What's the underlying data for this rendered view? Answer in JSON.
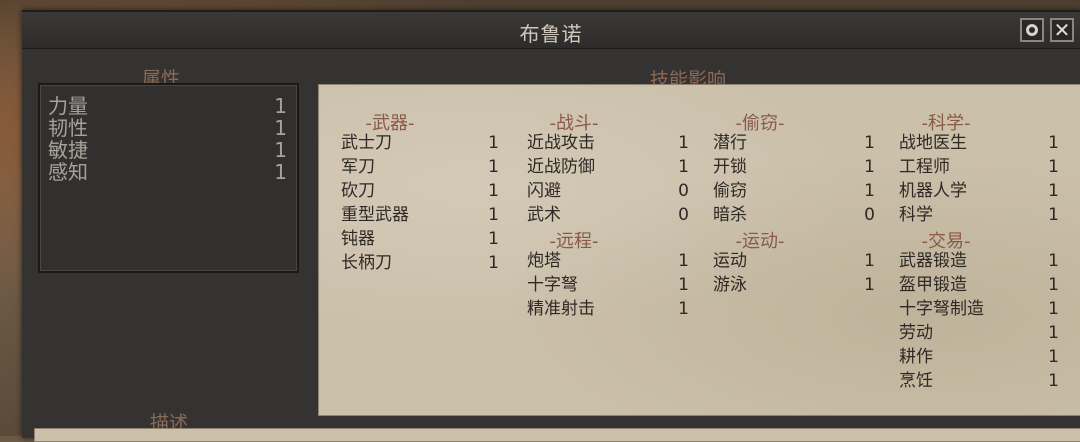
{
  "window": {
    "title": "布鲁诺"
  },
  "attributes": {
    "label": "属性",
    "items": [
      {
        "name": "力量",
        "value": "1"
      },
      {
        "name": "韧性",
        "value": "1"
      },
      {
        "name": "敏捷",
        "value": "1"
      },
      {
        "name": "感知",
        "value": "1"
      }
    ]
  },
  "skills": {
    "label": "技能影响",
    "categories": {
      "weapons": {
        "title": "-武器-",
        "items": [
          {
            "name": "武士刀",
            "value": "1"
          },
          {
            "name": "军刀",
            "value": "1"
          },
          {
            "name": "砍刀",
            "value": "1"
          },
          {
            "name": "重型武器",
            "value": "1"
          },
          {
            "name": "钝器",
            "value": "1"
          },
          {
            "name": "长柄刀",
            "value": "1"
          }
        ]
      },
      "combat": {
        "title": "-战斗-",
        "items": [
          {
            "name": "近战攻击",
            "value": "1"
          },
          {
            "name": "近战防御",
            "value": "1"
          },
          {
            "name": "闪避",
            "value": "0"
          },
          {
            "name": "武术",
            "value": "0"
          }
        ]
      },
      "ranged": {
        "title": "-远程-",
        "items": [
          {
            "name": "炮塔",
            "value": "1"
          },
          {
            "name": "十字弩",
            "value": "1"
          },
          {
            "name": "精准射击",
            "value": "1"
          }
        ]
      },
      "stealth": {
        "title": "-偷窃-",
        "items": [
          {
            "name": "潜行",
            "value": "1"
          },
          {
            "name": "开锁",
            "value": "1"
          },
          {
            "name": "偷窃",
            "value": "1"
          },
          {
            "name": "暗杀",
            "value": "0"
          }
        ]
      },
      "athletics": {
        "title": "-运动-",
        "items": [
          {
            "name": "运动",
            "value": "1"
          },
          {
            "name": "游泳",
            "value": "1"
          }
        ]
      },
      "science": {
        "title": "-科学-",
        "items": [
          {
            "name": "战地医生",
            "value": "1"
          },
          {
            "name": "工程师",
            "value": "1"
          },
          {
            "name": "机器人学",
            "value": "1"
          },
          {
            "name": "科学",
            "value": "1"
          }
        ]
      },
      "trade": {
        "title": "-交易-",
        "items": [
          {
            "name": "武器锻造",
            "value": "1"
          },
          {
            "name": "盔甲锻造",
            "value": "1"
          },
          {
            "name": "十字弩制造",
            "value": "1"
          },
          {
            "name": "劳动",
            "value": "1"
          },
          {
            "name": "耕作",
            "value": "1"
          },
          {
            "name": "烹饪",
            "value": "1"
          }
        ]
      }
    }
  },
  "description": {
    "label": "描述"
  },
  "icons": {
    "settings": "settings-ring-icon",
    "close": "close-icon"
  }
}
